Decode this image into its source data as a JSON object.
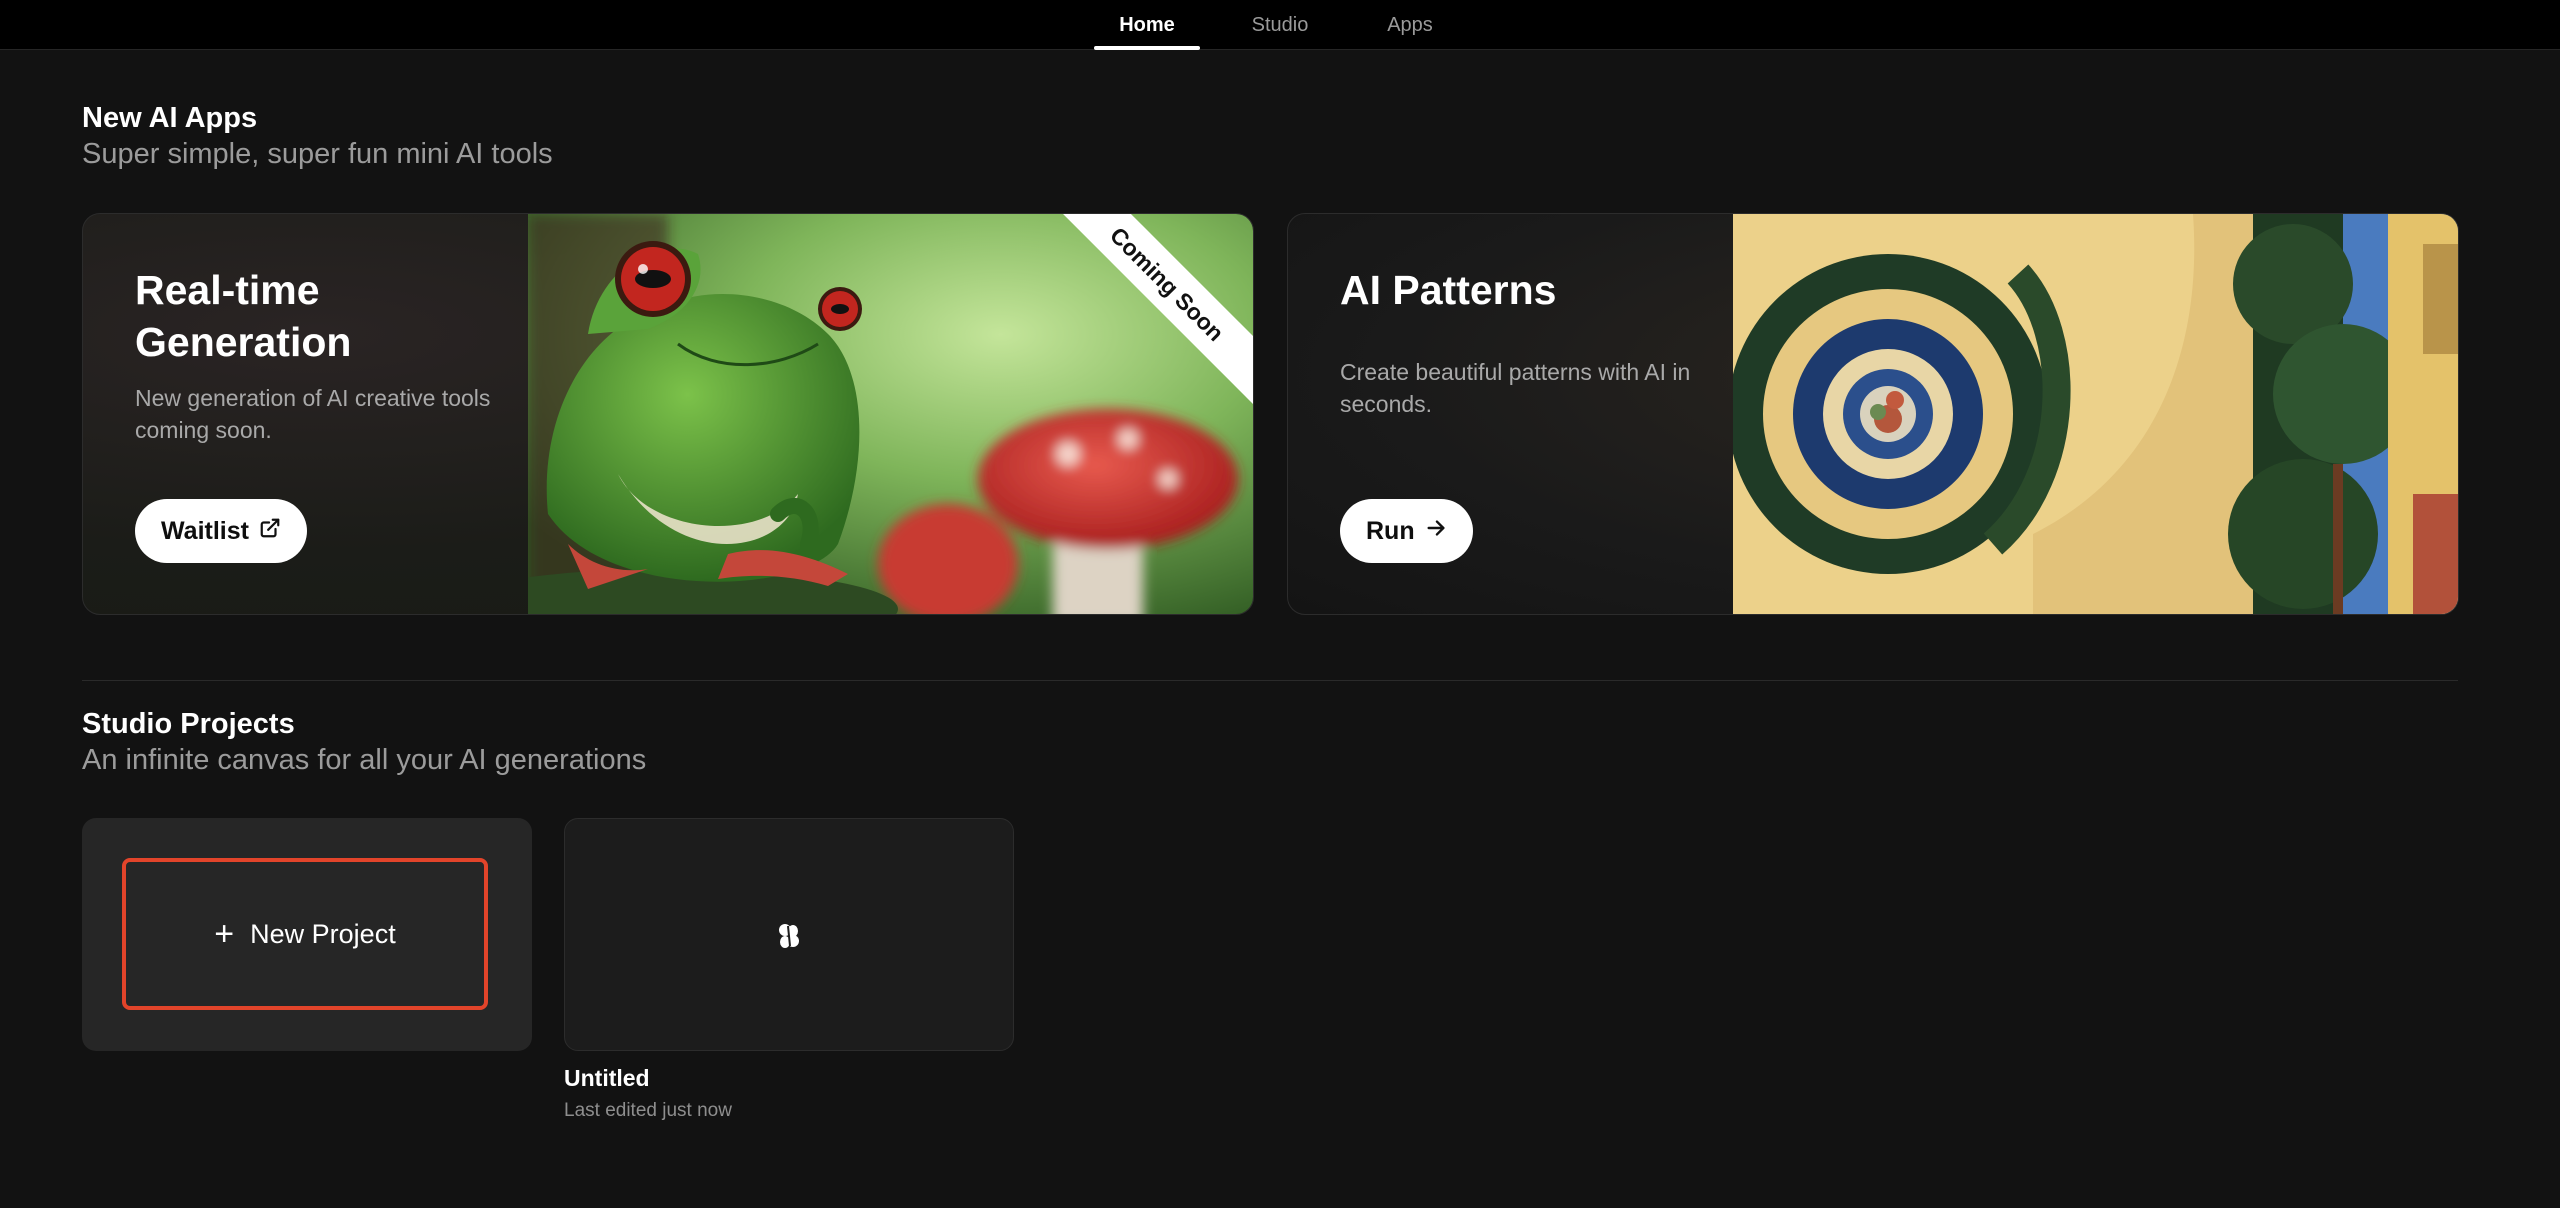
{
  "nav": {
    "tabs": [
      {
        "label": "Home",
        "active": true
      },
      {
        "label": "Studio",
        "active": false
      },
      {
        "label": "Apps",
        "active": false
      }
    ]
  },
  "apps_section": {
    "title": "New AI Apps",
    "subtitle": "Super simple, super fun mini AI tools",
    "cards": [
      {
        "title": "Real-time Generation",
        "description": "New generation of AI creative tools coming soon.",
        "button_label": "Waitlist",
        "button_icon": "external-link-icon",
        "ribbon": "Coming Soon",
        "image": "frog-on-mushroom-image"
      },
      {
        "title": "AI Patterns",
        "description": "Create beautiful patterns with AI in seconds.",
        "button_label": "Run",
        "button_icon": "arrow-right-icon",
        "image": "spiral-pattern-image"
      }
    ]
  },
  "projects_section": {
    "title": "Studio Projects",
    "subtitle": "An infinite canvas for all your AI generations",
    "new_project_label": "New Project",
    "projects": [
      {
        "name": "Untitled",
        "meta": "Last edited just now"
      }
    ]
  },
  "colors": {
    "background": "#121212",
    "accent_outline": "#e2442a"
  }
}
